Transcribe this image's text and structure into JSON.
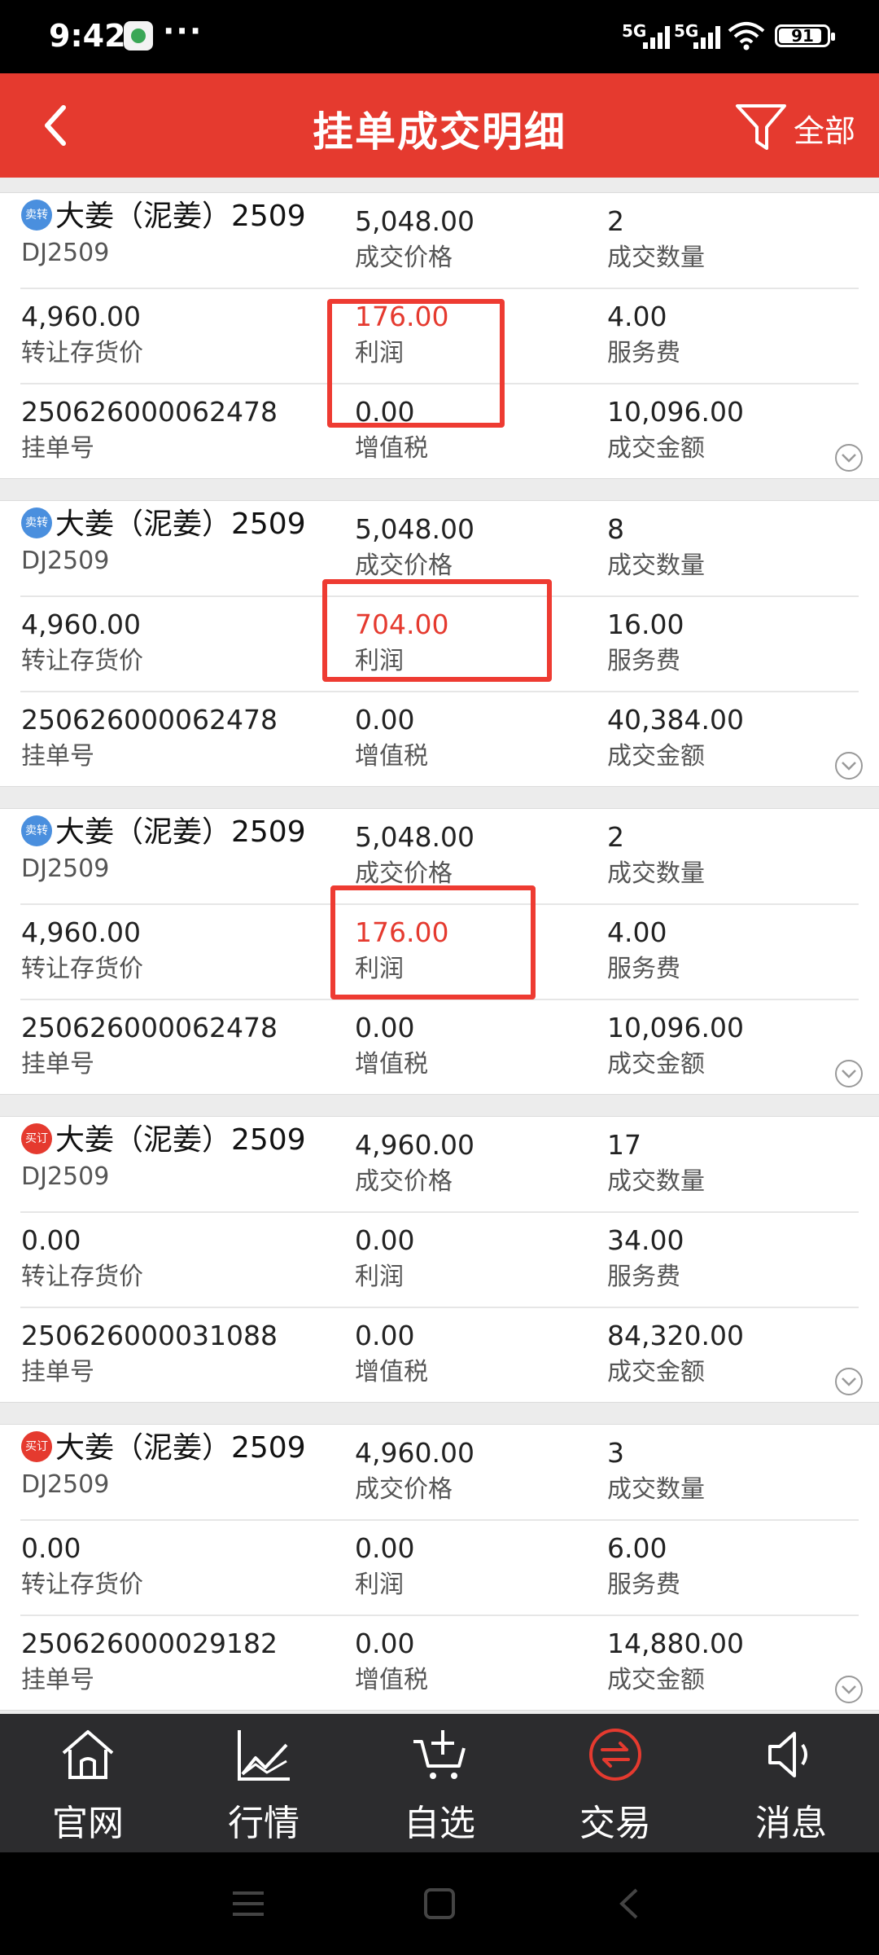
{
  "status_bar": {
    "time": "9:42",
    "dots": "···",
    "network1": "5G",
    "network2": "5G",
    "battery": "91"
  },
  "header": {
    "title": "挂单成交明细",
    "filter_label": "全部"
  },
  "labels": {
    "deal_price": "成交价格",
    "deal_qty": "成交数量",
    "transfer_price": "转让存货价",
    "profit": "利润",
    "service_fee": "服务费",
    "order_no": "挂单号",
    "vat": "增值税",
    "deal_amount": "成交金额"
  },
  "records": [
    {
      "badge": "卖转",
      "badge_type": "sell",
      "product": "大姜（泥姜）2509",
      "code": "DJ2509",
      "deal_price": "5,048.00",
      "deal_qty": "2",
      "transfer_price": "4,960.00",
      "profit": "176.00",
      "service_fee": "4.00",
      "order_no": "250626000062478",
      "vat": "0.00",
      "deal_amount": "10,096.00"
    },
    {
      "badge": "卖转",
      "badge_type": "sell",
      "product": "大姜（泥姜）2509",
      "code": "DJ2509",
      "deal_price": "5,048.00",
      "deal_qty": "8",
      "transfer_price": "4,960.00",
      "profit": "704.00",
      "service_fee": "16.00",
      "order_no": "250626000062478",
      "vat": "0.00",
      "deal_amount": "40,384.00"
    },
    {
      "badge": "卖转",
      "badge_type": "sell",
      "product": "大姜（泥姜）2509",
      "code": "DJ2509",
      "deal_price": "5,048.00",
      "deal_qty": "2",
      "transfer_price": "4,960.00",
      "profit": "176.00",
      "service_fee": "4.00",
      "order_no": "250626000062478",
      "vat": "0.00",
      "deal_amount": "10,096.00"
    },
    {
      "badge": "买订",
      "badge_type": "buy",
      "product": "大姜（泥姜）2509",
      "code": "DJ2509",
      "deal_price": "4,960.00",
      "deal_qty": "17",
      "transfer_price": "0.00",
      "profit": "0.00",
      "service_fee": "34.00",
      "order_no": "250626000031088",
      "vat": "0.00",
      "deal_amount": "84,320.00"
    },
    {
      "badge": "买订",
      "badge_type": "buy",
      "product": "大姜（泥姜）2509",
      "code": "DJ2509",
      "deal_price": "4,960.00",
      "deal_qty": "3",
      "transfer_price": "0.00",
      "profit": "0.00",
      "service_fee": "6.00",
      "order_no": "250626000029182",
      "vat": "0.00",
      "deal_amount": "14,880.00"
    }
  ],
  "bottom_nav": [
    {
      "label": "官网",
      "icon": "home-icon"
    },
    {
      "label": "行情",
      "icon": "chart-icon"
    },
    {
      "label": "自选",
      "icon": "cart-add-icon"
    },
    {
      "label": "交易",
      "icon": "trade-exchange-icon",
      "active": true
    },
    {
      "label": "消息",
      "icon": "speaker-icon"
    }
  ],
  "colors": {
    "brand_red": "#e53a2f",
    "sell_badge": "#4a8fde",
    "buy_badge": "#e53a2f",
    "nav_bg": "#2c2c2e"
  }
}
